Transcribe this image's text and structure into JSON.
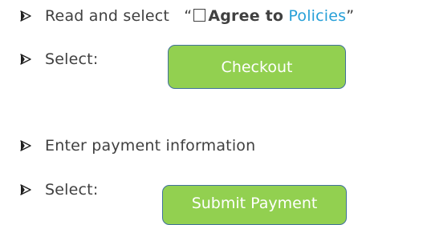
{
  "steps": [
    {
      "prefix": "Read and select",
      "open_quote": "“",
      "bold": "Agree to",
      "link": "Policies",
      "close_quote": "”"
    },
    {
      "text": "Select:"
    },
    {
      "text": "Enter payment information"
    },
    {
      "text": "Select:"
    }
  ],
  "buttons": {
    "checkout": "Checkout",
    "submit_payment": "Submit Payment"
  },
  "colors": {
    "button_fill": "#92d050",
    "button_border": "#41719c",
    "link": "#27a0d8",
    "text": "#404040"
  },
  "icons": {
    "bullet": "arrowhead-bullet-icon",
    "checkbox": "empty-checkbox-icon"
  }
}
